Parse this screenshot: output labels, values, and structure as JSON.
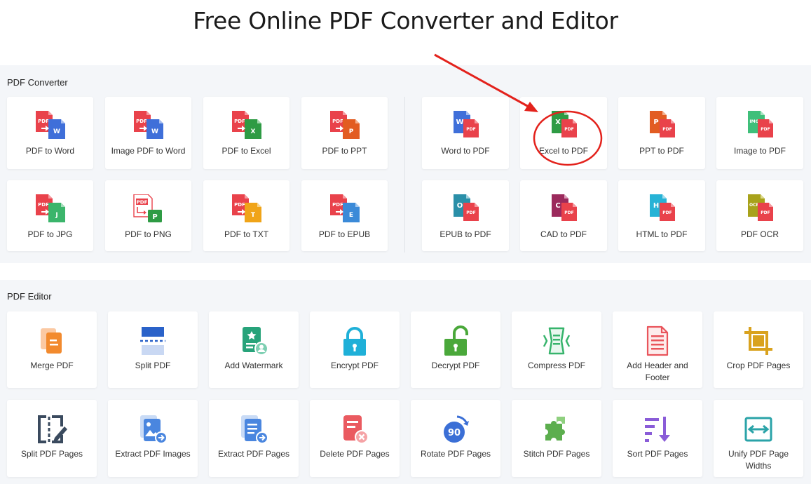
{
  "page_title": "Free Online PDF Converter and Editor",
  "converter": {
    "section_label": "PDF Converter",
    "items": [
      {
        "label": "PDF to Word",
        "icon": "pdf-to-word-icon"
      },
      {
        "label": "Image PDF to Word",
        "icon": "image-pdf-to-word-icon"
      },
      {
        "label": "PDF to Excel",
        "icon": "pdf-to-excel-icon"
      },
      {
        "label": "PDF to PPT",
        "icon": "pdf-to-ppt-icon"
      },
      {
        "label": "Word to PDF",
        "icon": "word-to-pdf-icon"
      },
      {
        "label": "Excel to PDF",
        "icon": "excel-to-pdf-icon"
      },
      {
        "label": "PPT to PDF",
        "icon": "ppt-to-pdf-icon"
      },
      {
        "label": "Image to PDF",
        "icon": "image-to-pdf-icon"
      },
      {
        "label": "PDF to JPG",
        "icon": "pdf-to-jpg-icon"
      },
      {
        "label": "PDF to PNG",
        "icon": "pdf-to-png-icon"
      },
      {
        "label": "PDF to TXT",
        "icon": "pdf-to-txt-icon"
      },
      {
        "label": "PDF to EPUB",
        "icon": "pdf-to-epub-icon"
      },
      {
        "label": "EPUB to PDF",
        "icon": "epub-to-pdf-icon"
      },
      {
        "label": "CAD to PDF",
        "icon": "cad-to-pdf-icon"
      },
      {
        "label": "HTML to PDF",
        "icon": "html-to-pdf-icon"
      },
      {
        "label": "PDF OCR",
        "icon": "pdf-ocr-icon"
      }
    ]
  },
  "editor": {
    "section_label": "PDF Editor",
    "items": [
      {
        "label": "Merge PDF",
        "icon": "merge-icon"
      },
      {
        "label": "Split PDF",
        "icon": "split-icon"
      },
      {
        "label": "Add Watermark",
        "icon": "watermark-icon"
      },
      {
        "label": "Encrypt PDF",
        "icon": "lock-icon"
      },
      {
        "label": "Decrypt PDF",
        "icon": "unlock-icon"
      },
      {
        "label": "Compress PDF",
        "icon": "compress-icon"
      },
      {
        "label": "Add Header and Footer",
        "icon": "header-footer-icon"
      },
      {
        "label": "Crop PDF Pages",
        "icon": "crop-icon"
      },
      {
        "label": "Split PDF Pages",
        "icon": "split-pages-icon"
      },
      {
        "label": "Extract PDF Images",
        "icon": "extract-images-icon"
      },
      {
        "label": "Extract PDF Pages",
        "icon": "extract-pages-icon"
      },
      {
        "label": "Delete PDF Pages",
        "icon": "delete-pages-icon"
      },
      {
        "label": "Rotate PDF Pages",
        "icon": "rotate-icon"
      },
      {
        "label": "Stitch PDF Pages",
        "icon": "puzzle-icon"
      },
      {
        "label": "Sort PDF Pages",
        "icon": "sort-icon"
      },
      {
        "label": "Unify PDF Page Widths",
        "icon": "unify-width-icon"
      }
    ]
  },
  "icon_text": {
    "pdf": "PDF",
    "w": "W",
    "x": "X",
    "p": "P",
    "j": "J",
    "t": "T",
    "e": "E",
    "o": "O",
    "c": "C",
    "h": "H",
    "img": "IMG",
    "ocr": "OCR",
    "rotate_num": "90"
  },
  "colors": {
    "pdf_red": "#e9424b",
    "word_blue": "#3f6fd9",
    "excel_green": "#2e9b44",
    "ppt_orange": "#e25c22",
    "image_green": "#3fbf7a",
    "epub_teal": "#2a8fa8",
    "cad_purple": "#9b2a5c",
    "html_teal": "#27b3d6",
    "ocr_olive": "#a8a21b",
    "txt_amber": "#f0a418",
    "epub_blue": "#3b8ad8",
    "jpg_green": "#3bb56b",
    "annotation_red": "#e3221c"
  }
}
